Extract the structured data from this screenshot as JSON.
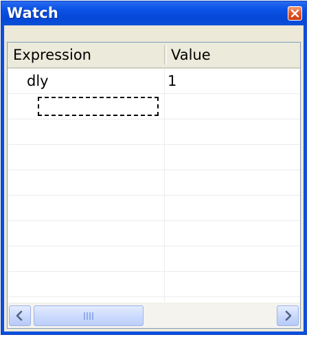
{
  "window": {
    "title": "Watch",
    "close_icon": "close-icon"
  },
  "table": {
    "columns": [
      "Expression",
      "Value"
    ],
    "rows": [
      {
        "expression": "dly",
        "value": "1"
      },
      {
        "expression": "",
        "value": "",
        "editing": true
      },
      {
        "expression": "",
        "value": ""
      },
      {
        "expression": "",
        "value": ""
      },
      {
        "expression": "",
        "value": ""
      },
      {
        "expression": "",
        "value": ""
      },
      {
        "expression": "",
        "value": ""
      },
      {
        "expression": "",
        "value": ""
      },
      {
        "expression": "",
        "value": ""
      }
    ]
  },
  "scrollbar": {
    "left_icon": "chevron-left-icon",
    "right_icon": "chevron-right-icon",
    "thumb_grip_icon": "grip-icon"
  },
  "colors": {
    "titlebar": "#0a52e6",
    "close_button": "#e3582c",
    "client_background": "#ece9d8",
    "header_background": "#ebeadb",
    "scroll_button": "#c6d6fb"
  }
}
